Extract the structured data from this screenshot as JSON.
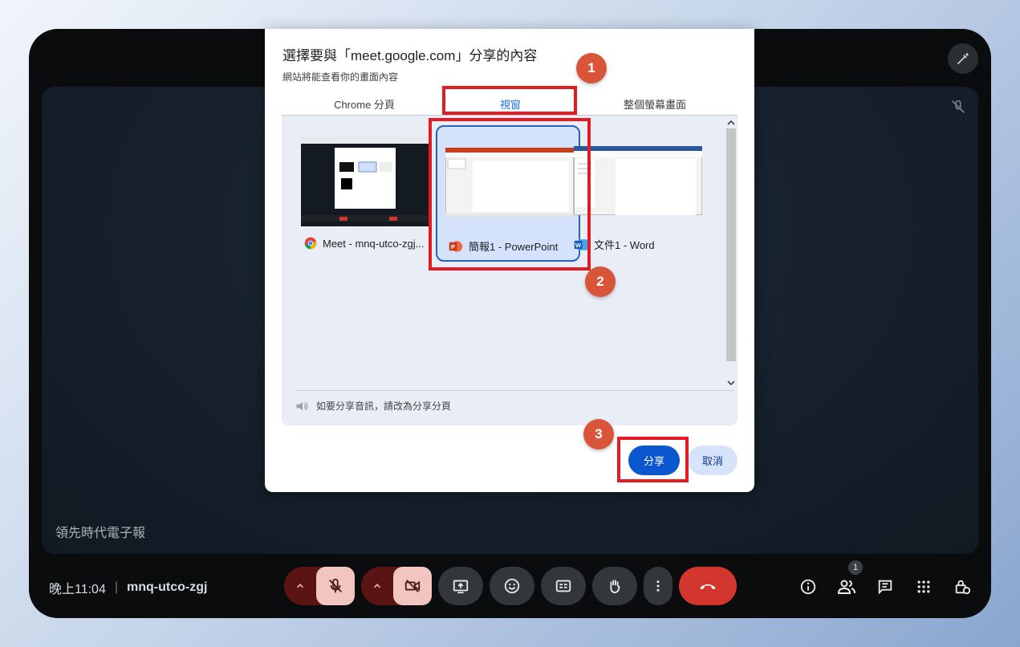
{
  "meeting": {
    "stage_name": "領先時代電子報",
    "time": "晚上11:04",
    "separator": "|",
    "code": "mnq-utco-zgj",
    "people_badge": "1"
  },
  "dialog": {
    "title": "選擇要與「meet.google.com」分享的內容",
    "subtitle": "網站將能查看你的畫面內容",
    "tabs": [
      "Chrome 分頁",
      "視窗",
      "整個螢幕畫面"
    ],
    "active_tab": "視窗",
    "windows": [
      {
        "label": "Meet - mnq-utco-zgj...",
        "icon": "chrome-icon"
      },
      {
        "label": "簡報1 - PowerPoint",
        "icon": "powerpoint-icon",
        "selected": true
      },
      {
        "label": "文件1 - Word",
        "icon": "word-icon"
      }
    ],
    "audio_note": "如要分享音訊，請改為分享分頁",
    "share_button": "分享",
    "cancel_button": "取消"
  },
  "annotations": [
    "1",
    "2",
    "3"
  ],
  "colors": {
    "accent": "#1a73e8",
    "primary_button": "#0b57d0",
    "annotation_red": "#e31b23",
    "annotation_badge": "#d9553a",
    "end_call": "#d3362d"
  }
}
